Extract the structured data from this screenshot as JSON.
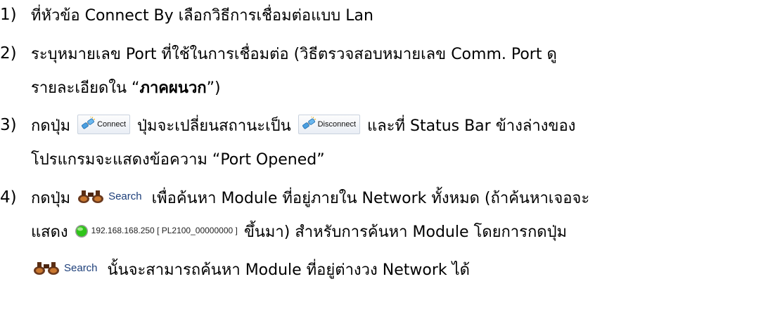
{
  "steps": [
    {
      "num": "1)",
      "lines": [
        {
          "parts": [
            "ที่หัวข้อ Connect By เลือกวิธีการเชื่อมต่อแบบ Lan"
          ]
        }
      ]
    },
    {
      "num": "2)",
      "lines": [
        {
          "parts": [
            "ระบุหมายเลข Port ที่ใช้ในการเชื่อมต่อ (วิธีตรวจสอบหมายเลข Comm. Port ดู"
          ]
        },
        {
          "parts": [
            "รายละเอียดใน “",
            "ภาคผนวก",
            "”)"
          ]
        }
      ]
    },
    {
      "num": "3)",
      "lines": [
        {
          "parts": [
            "กดปุ่ม ",
            " ปุ่มจะเปลี่ยนสถานะเป็น ",
            " และที่ Status Bar ข้างล่างของ"
          ]
        },
        {
          "parts": [
            "โปรแกรมจะแสดงข้อความ “Port Opened”"
          ]
        }
      ]
    },
    {
      "num": "4)",
      "lines": [
        {
          "parts": [
            "กดปุ่ม ",
            " เพื่อค้นหา Module ที่อยู่ภายใน Network ทั้งหมด (ถ้าค้นหาเจอจะ"
          ]
        },
        {
          "parts": [
            "แสดง ",
            " ขึ้นมา) สำหรับการค้นหา Module โดยการกดปุ่ม"
          ]
        },
        {
          "parts": [
            " นั้นจะสามารถค้นหา Module ที่อยู่ต่างวง Network ได้"
          ]
        }
      ]
    }
  ],
  "buttons": {
    "connect_label": "Connect",
    "disconnect_label": "Disconnect",
    "search_label": "Search"
  },
  "status_chip": {
    "text": "192.168.168.250 [ PL2100_00000000 ]",
    "color": "#2fc41a"
  },
  "icons": {
    "connect": "plug-connect-icon",
    "search": "binoculars-icon",
    "status": "green-status-dot-icon"
  }
}
